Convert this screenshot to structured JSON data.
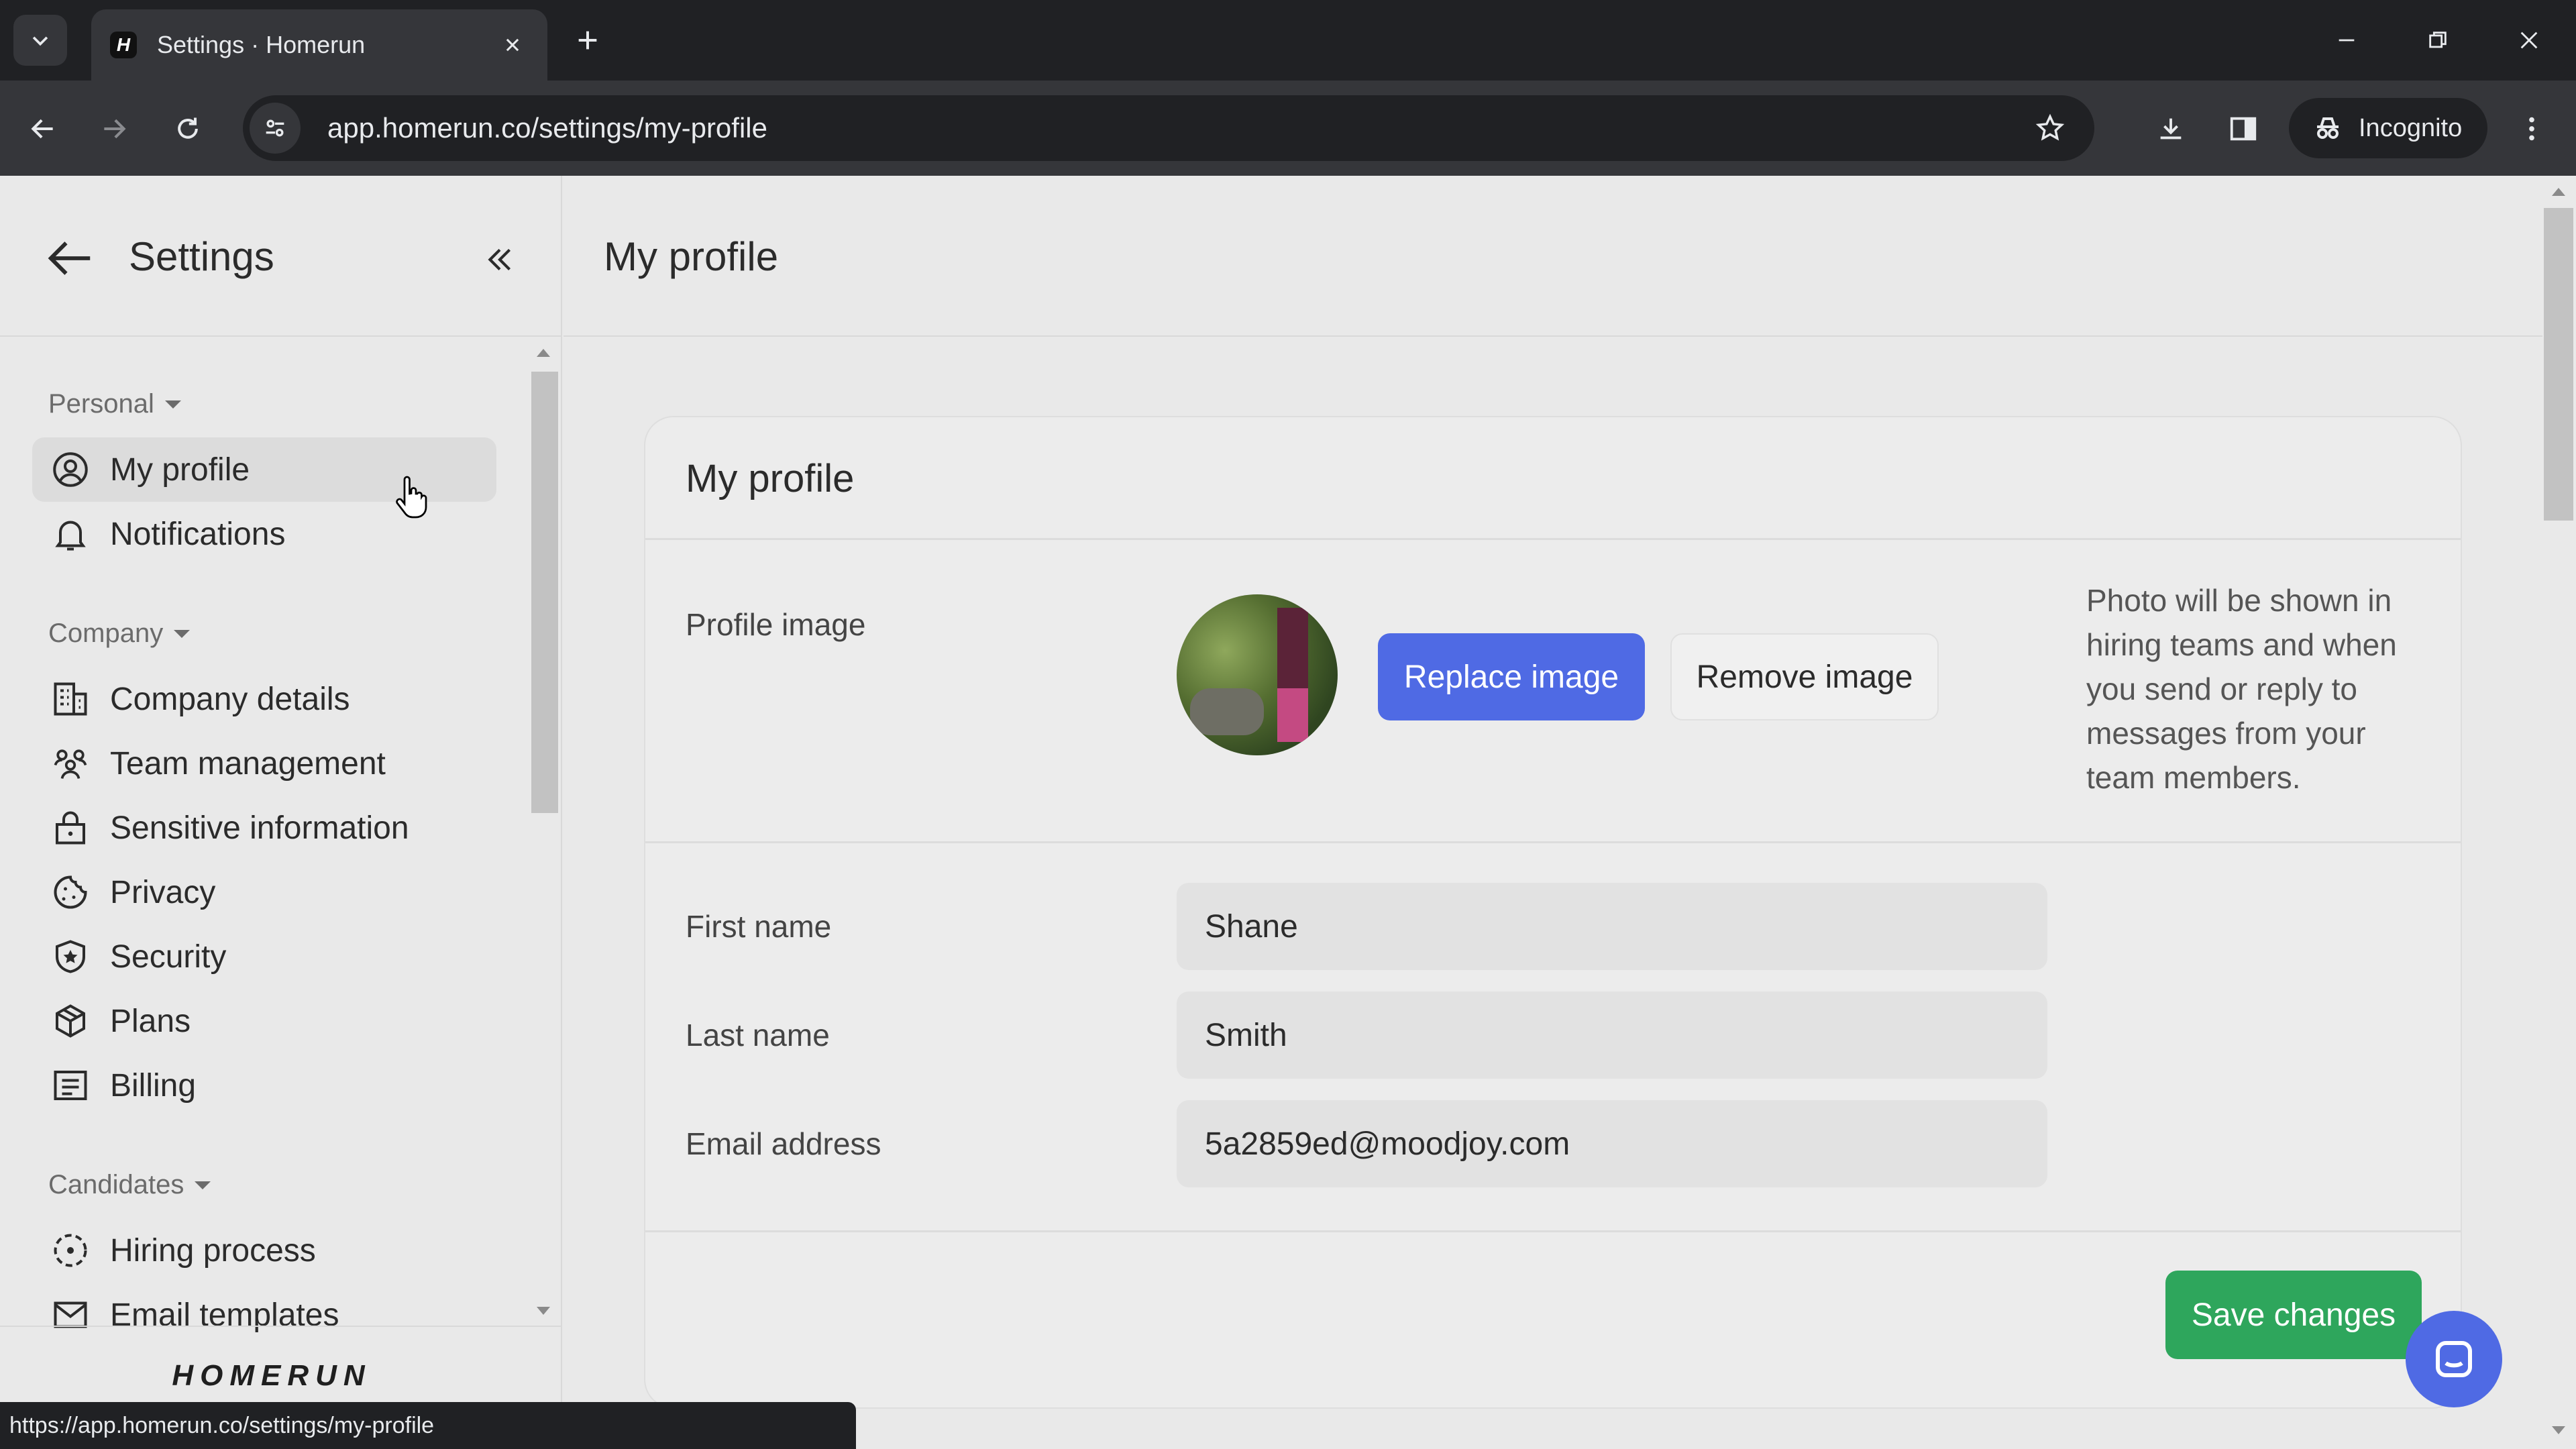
{
  "browser": {
    "tab_title": "Settings · Homerun",
    "favicon_letter": "H",
    "url": "app.homerun.co/settings/my-profile",
    "incognito_label": "Incognito",
    "status_url": "https://app.homerun.co/settings/my-profile"
  },
  "sidebar": {
    "title": "Settings",
    "sections": [
      {
        "label": "Personal",
        "items": [
          {
            "label": "My profile",
            "icon": "user-circle-icon",
            "active": true
          },
          {
            "label": "Notifications",
            "icon": "bell-icon"
          }
        ]
      },
      {
        "label": "Company",
        "items": [
          {
            "label": "Company details",
            "icon": "building-icon"
          },
          {
            "label": "Team management",
            "icon": "team-icon"
          },
          {
            "label": "Sensitive information",
            "icon": "lock-icon"
          },
          {
            "label": "Privacy",
            "icon": "cookie-icon"
          },
          {
            "label": "Security",
            "icon": "shield-star-icon"
          },
          {
            "label": "Plans",
            "icon": "box-icon"
          },
          {
            "label": "Billing",
            "icon": "receipt-icon"
          }
        ]
      },
      {
        "label": "Candidates",
        "items": [
          {
            "label": "Hiring process",
            "icon": "hiring-process-icon"
          },
          {
            "label": "Email templates",
            "icon": "envelope-icon"
          }
        ]
      }
    ],
    "logo_text": "HOMERUN"
  },
  "main": {
    "header_title": "My profile",
    "card": {
      "title": "My profile",
      "profile_image_label": "Profile image",
      "replace_label": "Replace image",
      "remove_label": "Remove image",
      "photo_help": "Photo will be shown in hiring teams and when you send or reply to messages from your team members.",
      "first_name_label": "First name",
      "first_name_value": "Shane",
      "last_name_label": "Last name",
      "last_name_value": "Smith",
      "email_label": "Email address",
      "email_value": "5a2859ed@moodjoy.com",
      "save_label": "Save changes"
    }
  },
  "colors": {
    "primary": "#4f6ae4",
    "success": "#2ea65c",
    "chrome_dark": "#202124",
    "chrome_toolbar": "#35363a"
  }
}
